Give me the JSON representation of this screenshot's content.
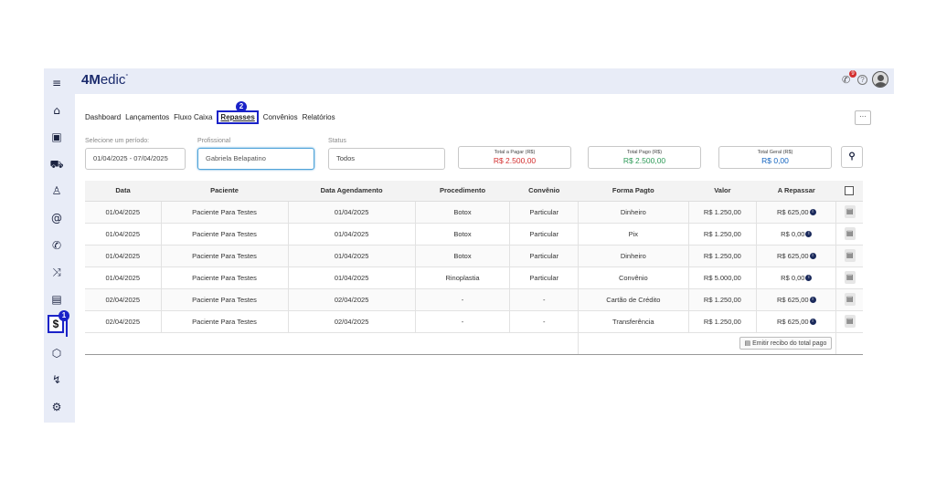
{
  "app": {
    "logo_bold": "4M",
    "logo_rest": "edic",
    "logo_mark": "°"
  },
  "header": {
    "notification_count": "9"
  },
  "annotations": {
    "badge_1": "1",
    "badge_2": "2"
  },
  "sidebar": {
    "items": [
      {
        "name": "menu-icon",
        "glyph": "≡"
      },
      {
        "name": "home-icon",
        "glyph": "⌂"
      },
      {
        "name": "calendar-icon",
        "glyph": "▣"
      },
      {
        "name": "car-icon",
        "glyph": "⛟"
      },
      {
        "name": "users-icon",
        "glyph": "♙"
      },
      {
        "name": "at-icon",
        "glyph": "@"
      },
      {
        "name": "phone-icon",
        "glyph": "✆"
      },
      {
        "name": "shuffle-icon",
        "glyph": "⤨"
      },
      {
        "name": "clipboard-icon",
        "glyph": "▤"
      },
      {
        "name": "dollar-icon",
        "glyph": "$"
      },
      {
        "name": "box-icon",
        "glyph": "⬡"
      },
      {
        "name": "chart-icon",
        "glyph": "↯"
      },
      {
        "name": "settings-icon",
        "glyph": "⚙"
      }
    ]
  },
  "tabs": [
    {
      "label": "Dashboard"
    },
    {
      "label": "Lançamentos"
    },
    {
      "label": "Fluxo Caixa"
    },
    {
      "label": "Repasses",
      "active": true
    },
    {
      "label": "Convênios"
    },
    {
      "label": "Relatórios"
    }
  ],
  "more_label": "···",
  "filters": {
    "period_label": "Selecione um período:",
    "period_value": "01/04/2025 - 07/04/2025",
    "professional_label": "Profissional",
    "professional_value": "Gabriela Belapatino",
    "status_label": "Status",
    "status_value": "Todos"
  },
  "totals": {
    "to_pay_label": "Total a Pagar (R$)",
    "to_pay_value": "R$ 2.500,00",
    "paid_label": "Total Pago (R$)",
    "paid_value": "R$ 2.500,00",
    "general_label": "Total Geral (R$)",
    "general_value": "R$ 0,00",
    "colors": {
      "to_pay": "#d32f2f",
      "paid": "#2e9a58",
      "general": "#1565c0"
    }
  },
  "table": {
    "columns": [
      "Data",
      "Paciente",
      "Data Agendamento",
      "Procedimento",
      "Convênio",
      "Forma Pagto",
      "Valor",
      "A Repassar"
    ],
    "rows": [
      [
        "01/04/2025",
        "Paciente Para Testes",
        "01/04/2025",
        "Botox",
        "Particular",
        "Dinheiro",
        "R$ 1.250,00",
        "R$ 625,00"
      ],
      [
        "01/04/2025",
        "Paciente Para Testes",
        "01/04/2025",
        "Botox",
        "Particular",
        "Pix",
        "R$ 1.250,00",
        "R$ 0,00"
      ],
      [
        "01/04/2025",
        "Paciente Para Testes",
        "01/04/2025",
        "Botox",
        "Particular",
        "Dinheiro",
        "R$ 1.250,00",
        "R$ 625,00"
      ],
      [
        "01/04/2025",
        "Paciente Para Testes",
        "01/04/2025",
        "Rinoplastia",
        "Particular",
        "Convênio",
        "R$ 5.000,00",
        "R$ 0,00"
      ],
      [
        "02/04/2025",
        "Paciente Para Testes",
        "02/04/2025",
        "-",
        "-",
        "Cartão de Crédito",
        "R$ 1.250,00",
        "R$ 625,00"
      ],
      [
        "02/04/2025",
        "Paciente Para Testes",
        "02/04/2025",
        "-",
        "-",
        "Transferência",
        "R$ 1.250,00",
        "R$ 625,00"
      ]
    ],
    "emit_label": "Emitir recibo do total pago"
  }
}
